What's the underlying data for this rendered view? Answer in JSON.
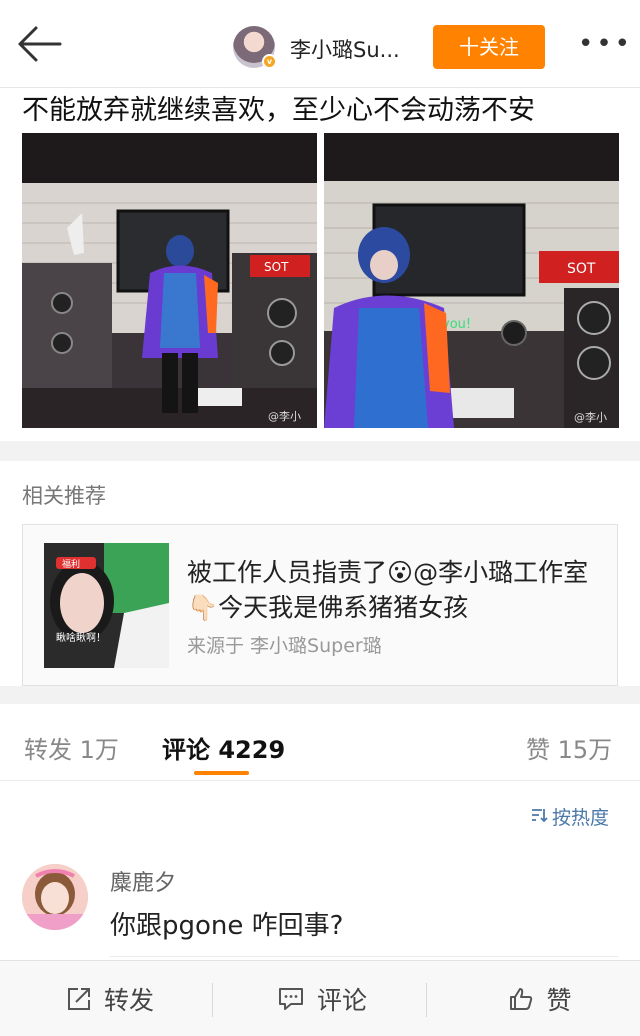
{
  "header": {
    "author_name": "李小璐Su...",
    "verified_badge": "v",
    "follow_label": "十关注",
    "more_label": "•••",
    "accent_color": "#ff8200"
  },
  "post": {
    "text": "不能放弃就继续喜欢，至少心不会动荡不安",
    "photo_watermark": "@李小",
    "photo_sign": "SOT",
    "photo_neon": "you!"
  },
  "related": {
    "section_label": "相关推荐",
    "title": "被工作人员指责了😮@李小璐工作室 👇🏻今天我是佛系猪猪女孩",
    "source": "来源于 李小璐Super璐",
    "thumb_text": "瞅啥瞅啊！",
    "thumb_badge": "福利"
  },
  "tabs": {
    "repost": "转发 1万",
    "comments": "评论 4229",
    "likes": "赞 15万"
  },
  "sort_label": "按热度",
  "comment": {
    "author": "麋鹿夕",
    "text": "你跟pgone 咋回事?"
  },
  "bottom_bar": {
    "repost": "转发",
    "comment": "评论",
    "like": "赞"
  }
}
